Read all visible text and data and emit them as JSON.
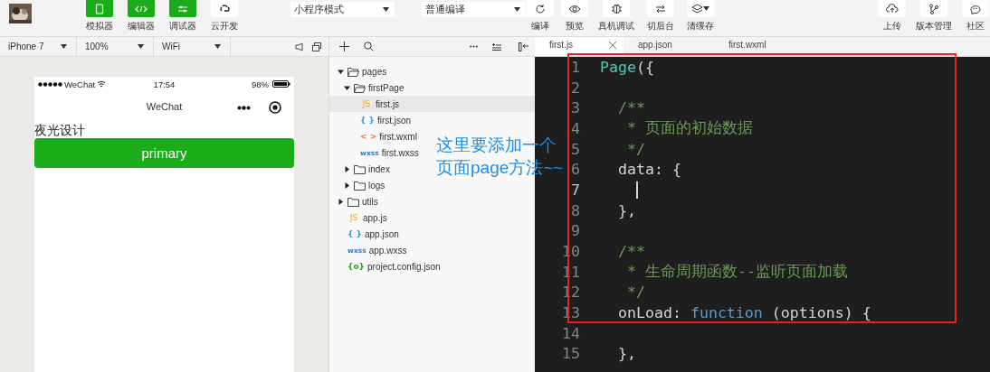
{
  "toolbar": {
    "modes": [
      {
        "label": "模拟器",
        "on": true
      },
      {
        "label": "编辑器",
        "on": true
      },
      {
        "label": "调试器",
        "on": true
      },
      {
        "label": "云开发",
        "on": false
      }
    ],
    "dropdowns": [
      {
        "value": "小程序模式"
      },
      {
        "value": "普通编译"
      }
    ],
    "actions": [
      {
        "label": "编译"
      },
      {
        "label": "预览"
      },
      {
        "label": "真机调试"
      },
      {
        "label": "切后台"
      },
      {
        "label": "清缓存"
      }
    ],
    "right_actions": [
      {
        "label": "上传"
      },
      {
        "label": "版本管理"
      },
      {
        "label": "社区"
      }
    ]
  },
  "simulator": {
    "dropdowns": [
      {
        "value": "iPhone 7"
      },
      {
        "value": "100%"
      },
      {
        "value": "WiFi"
      }
    ],
    "phone": {
      "carrier": "WeChat",
      "time": "17:54",
      "battery": "98%",
      "nav_title": "WeChat",
      "text": "夜光设计",
      "button": "primary"
    }
  },
  "explorer": {
    "tree": [
      {
        "name": "pages",
        "kind": "folder",
        "expanded": true,
        "selected": false,
        "children": [
          {
            "name": "firstPage",
            "kind": "folder",
            "expanded": true,
            "selected": false,
            "children": [
              {
                "name": "first.js",
                "kind": "js",
                "badge": "JS",
                "selected": true
              },
              {
                "name": "first.json",
                "kind": "json",
                "badge": "{ }",
                "selected": false
              },
              {
                "name": "first.wxml",
                "kind": "wxml",
                "badge": "< >",
                "selected": false
              },
              {
                "name": "first.wxss",
                "kind": "wxss",
                "badge": "wxss",
                "selected": false
              }
            ]
          },
          {
            "name": "index",
            "kind": "folder",
            "expanded": false,
            "selected": false
          },
          {
            "name": "logs",
            "kind": "folder",
            "expanded": false,
            "selected": false
          }
        ]
      },
      {
        "name": "utils",
        "kind": "folder",
        "expanded": false,
        "selected": false
      },
      {
        "name": "app.js",
        "kind": "js",
        "badge": "JS",
        "selected": false
      },
      {
        "name": "app.json",
        "kind": "json",
        "badge": "{ }",
        "selected": false
      },
      {
        "name": "app.wxss",
        "kind": "wxss",
        "badge": "wxss",
        "selected": false
      },
      {
        "name": "project.config.json",
        "kind": "config",
        "badge": "{o}",
        "selected": false
      }
    ]
  },
  "editor": {
    "tabs": [
      {
        "label": "first.js",
        "selected": true
      },
      {
        "label": "app.json",
        "selected": false
      },
      {
        "label": "first.wxml",
        "selected": false
      }
    ],
    "lines": [
      {
        "n": "1",
        "cursor": false,
        "tokens": [
          {
            "t": "Page",
            "color": "#4ec9b0"
          },
          {
            "t": "({",
            "color": "#d4d4d4"
          }
        ]
      },
      {
        "n": "2",
        "cursor": false
      },
      {
        "n": "3",
        "cursor": false,
        "tokens": [
          {
            "t": "  /**",
            "color": "#6a9955"
          }
        ]
      },
      {
        "n": "4",
        "cursor": false,
        "tokens": [
          {
            "t": "   * 页面的初始数据",
            "color": "#6a9955"
          }
        ]
      },
      {
        "n": "5",
        "cursor": false,
        "tokens": [
          {
            "t": "   */",
            "color": "#6a9955"
          }
        ]
      },
      {
        "n": "6",
        "cursor": false,
        "tokens": [
          {
            "t": "  data: {",
            "color": "#d4d4d4"
          }
        ]
      },
      {
        "n": "7",
        "cursor": true
      },
      {
        "n": "8",
        "cursor": false,
        "tokens": [
          {
            "t": "  },",
            "color": "#d4d4d4"
          }
        ]
      },
      {
        "n": "9",
        "cursor": false
      },
      {
        "n": "10",
        "cursor": false,
        "tokens": [
          {
            "t": "  /**",
            "color": "#6a9955"
          }
        ]
      },
      {
        "n": "11",
        "cursor": false,
        "tokens": [
          {
            "t": "   * 生命周期函数--监听页面加载",
            "color": "#6a9955"
          }
        ]
      },
      {
        "n": "12",
        "cursor": false,
        "tokens": [
          {
            "t": "   */",
            "color": "#6a9955"
          }
        ]
      },
      {
        "n": "13",
        "cursor": false,
        "tokens": [
          {
            "t": "  onLoad: ",
            "color": "#d4d4d4"
          },
          {
            "t": "function",
            "color": "#569cd6"
          },
          {
            "t": " (options) {",
            "color": "#d4d4d4"
          }
        ]
      },
      {
        "n": "14",
        "cursor": false
      },
      {
        "n": "15",
        "cursor": false,
        "tokens": [
          {
            "t": "  },",
            "color": "#d4d4d4"
          }
        ]
      }
    ]
  },
  "annotation": {
    "lines": [
      "这里要添加一个",
      "页面page方法~~"
    ]
  }
}
